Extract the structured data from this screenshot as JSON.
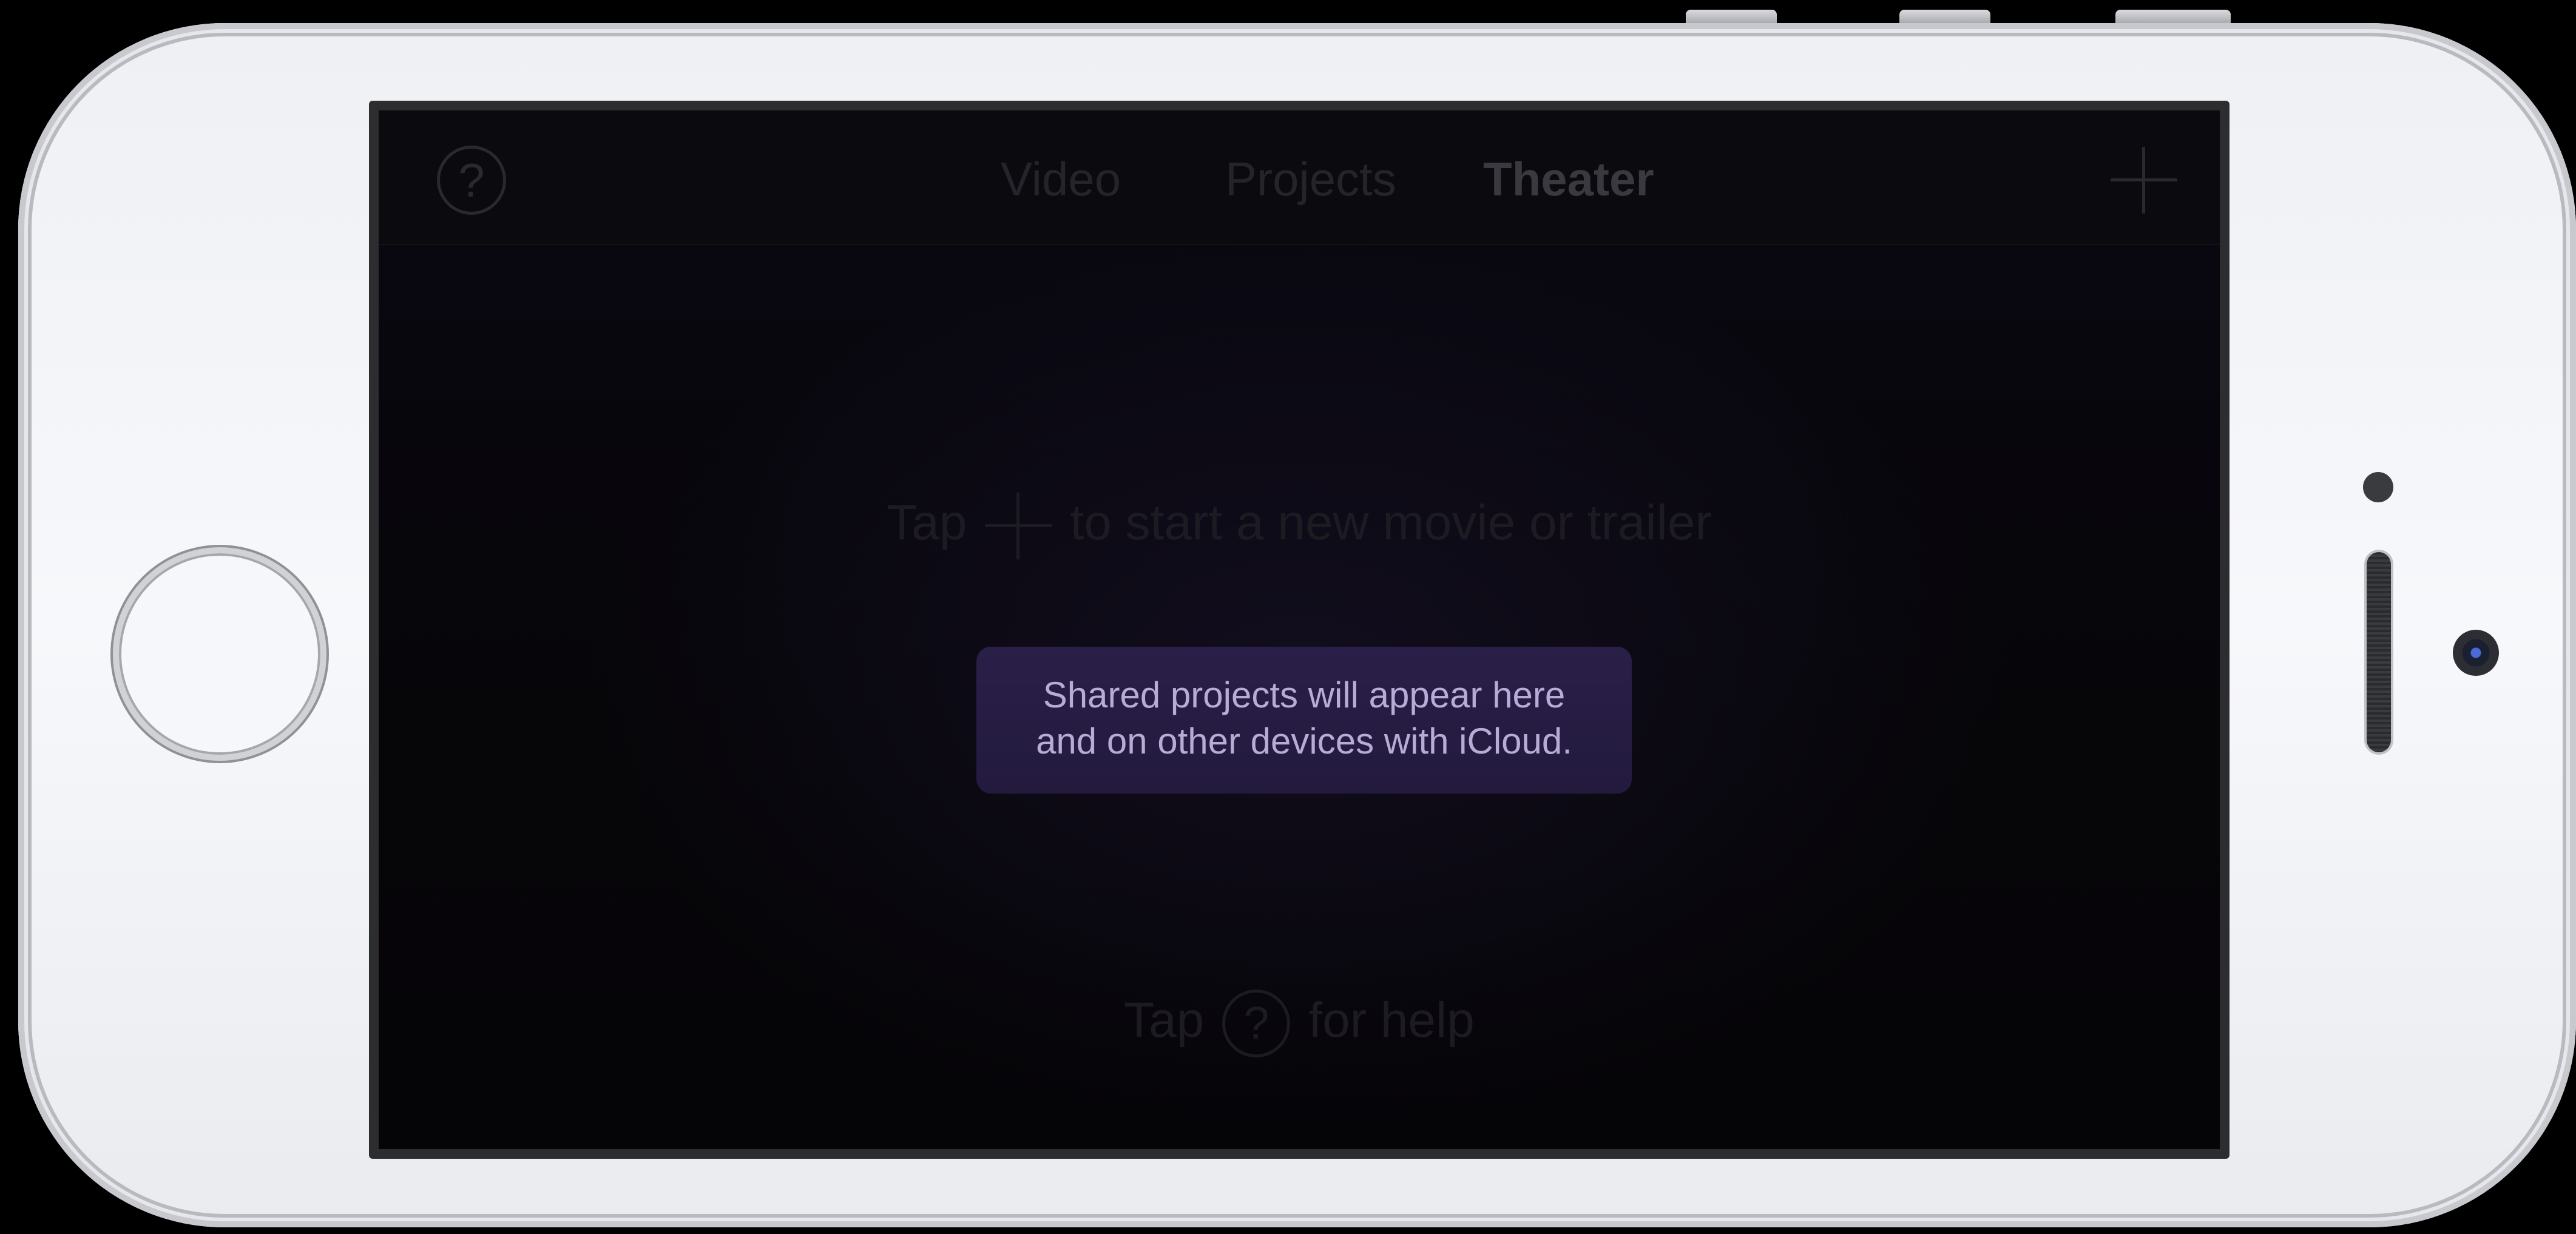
{
  "colors": {
    "screen_background": "#050407",
    "bubble_background": "#2a1f48",
    "bubble_text": "#b6acd6",
    "dim_text": "#25242b",
    "phone_body": "#f4f5f8"
  },
  "navbar": {
    "help_icon": "question-circle-icon",
    "help_symbol": "?",
    "tabs": [
      {
        "label": "Video",
        "active": false
      },
      {
        "label": "Projects",
        "active": false
      },
      {
        "label": "Theater",
        "active": true
      }
    ],
    "add_icon": "plus-icon"
  },
  "empty_state": {
    "new_prefix": "Tap",
    "new_icon": "plus-icon",
    "new_suffix": "to start a new movie or trailer",
    "icloud_line1": "Shared projects will appear here",
    "icloud_line2": "and on other devices with iCloud.",
    "help_prefix": "Tap",
    "help_icon": "question-circle-icon",
    "help_symbol": "?",
    "help_suffix": "for help"
  }
}
